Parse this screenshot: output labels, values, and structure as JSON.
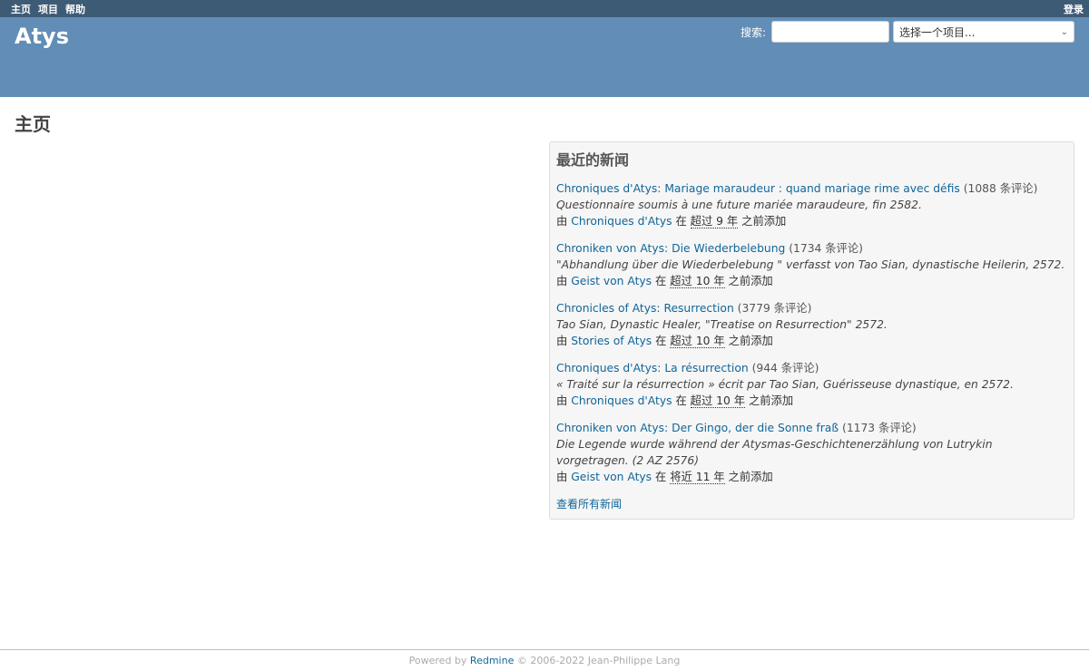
{
  "top_menu": {
    "left": [
      "主页",
      "项目",
      "帮助"
    ],
    "right": "登录"
  },
  "header": {
    "title": "Atys",
    "search_label": "搜索:",
    "search_value": "",
    "project_jump": "选择一个项目..."
  },
  "page_title": "主页",
  "news": {
    "heading": "最近的新闻",
    "items": [
      {
        "title": "Chroniques d'Atys: Mariage maraudeur : quand mariage rime avec défis",
        "comments": "(1088 条评论)",
        "summary": "Questionnaire soumis à une future mariée maraudeure, fin 2582.",
        "by": "由",
        "author": "Chroniques d'Atys",
        "at": "在",
        "age": "超过 9 年",
        "added": "之前添加"
      },
      {
        "title": "Chroniken von Atys: Die Wiederbelebung",
        "comments": "(1734 条评论)",
        "summary": "\"Abhandlung über die Wiederbelebung \" verfasst von Tao Sian, dynastische Heilerin, 2572.",
        "by": "由",
        "author": "Geist von Atys",
        "at": "在",
        "age": "超过 10 年",
        "added": "之前添加"
      },
      {
        "title": "Chronicles of Atys: Resurrection",
        "comments": "(3779 条评论)",
        "summary": "Tao Sian, Dynastic Healer, \"Treatise on Resurrection\" 2572.",
        "by": "由",
        "author": "Stories of Atys",
        "at": "在",
        "age": "超过 10 年",
        "added": "之前添加"
      },
      {
        "title": "Chroniques d'Atys: La résurrection",
        "comments": "(944 条评论)",
        "summary": "« Traité sur la résurrection » écrit par Tao Sian, Guérisseuse dynastique, en 2572.",
        "by": "由",
        "author": "Chroniques d'Atys",
        "at": "在",
        "age": "超过 10 年",
        "added": "之前添加"
      },
      {
        "title": "Chroniken von Atys: Der Gingo, der die Sonne fraß",
        "comments": "(1173 条评论)",
        "summary": "Die Legende wurde während der Atysmas-Geschichtenerzählung von Lutrykin vorgetragen. (2 AZ 2576)",
        "by": "由",
        "author": "Geist von Atys",
        "at": "在",
        "age": "将近 11 年",
        "added": "之前添加"
      }
    ],
    "view_all": "查看所有新闻"
  },
  "footer": {
    "powered_by": "Powered by",
    "redmine": "Redmine",
    "copyright": "© 2006-2022 Jean-Philippe Lang"
  }
}
